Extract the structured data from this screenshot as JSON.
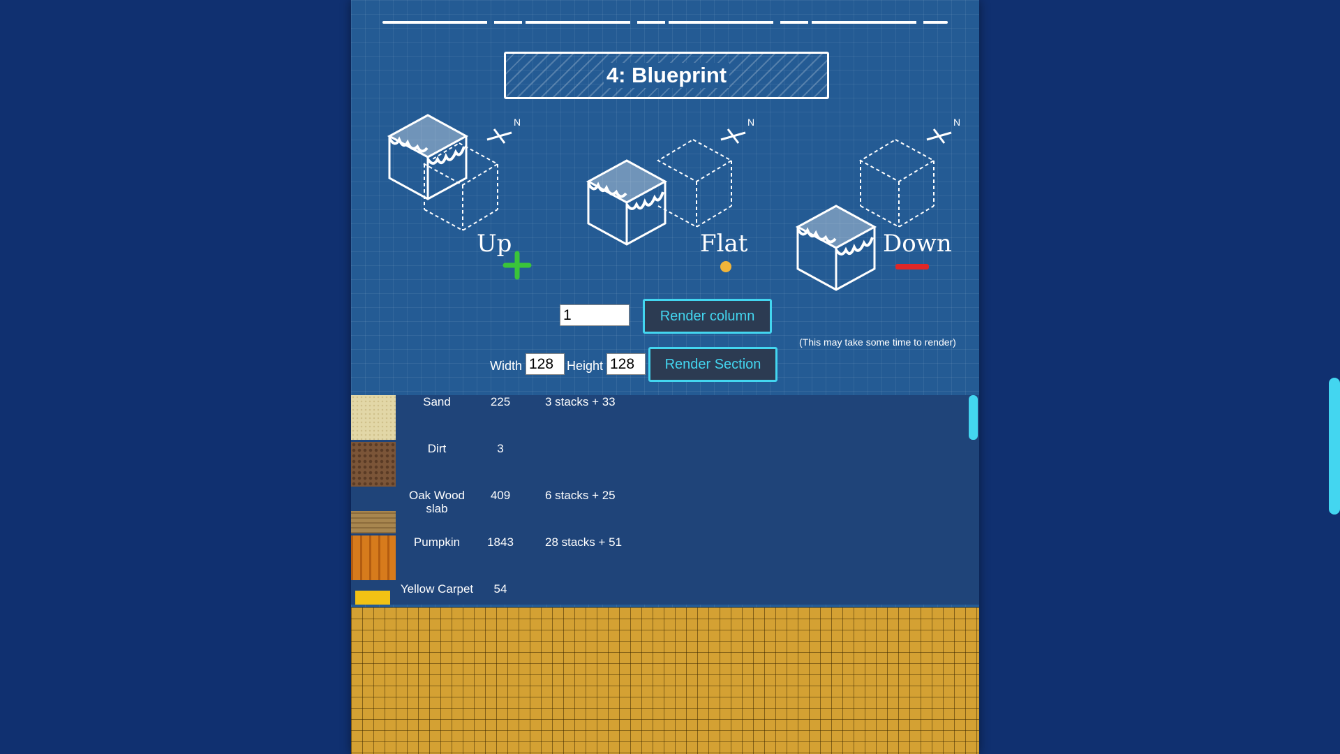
{
  "section": {
    "title": "4: Blueprint"
  },
  "diagrams": [
    {
      "label": "Up",
      "symbol": "plus",
      "color": "#3ac43a"
    },
    {
      "label": "Flat",
      "symbol": "dot",
      "color": "#f1b53a"
    },
    {
      "label": "Down",
      "symbol": "minus",
      "color": "#e02727"
    }
  ],
  "compass_label": "N",
  "controls": {
    "column_value": "1",
    "render_column_label": "Render column",
    "width_label": "Width",
    "width_value": "128",
    "height_label": "Height",
    "height_value": "128",
    "render_section_label": "Render Section",
    "note": "(This may take some time to render)"
  },
  "materials": [
    {
      "name": "Sand",
      "count": "225",
      "stacks": "3 stacks + 33",
      "texture": "sand"
    },
    {
      "name": "Dirt",
      "count": "3",
      "stacks": "",
      "texture": "dirt"
    },
    {
      "name": "Oak Wood slab",
      "count": "409",
      "stacks": "6 stacks + 25",
      "texture": "oak-slab"
    },
    {
      "name": "Pumpkin",
      "count": "1843",
      "stacks": "28 stacks + 51",
      "texture": "pumpkin"
    },
    {
      "name": "Yellow Carpet",
      "count": "54",
      "stacks": "",
      "texture": "yellow-carpet"
    }
  ],
  "colors": {
    "accent": "#43d6f0",
    "panel_bg": "#245b94",
    "page_bg": "#103070",
    "button_bg": "#2c3b52"
  }
}
